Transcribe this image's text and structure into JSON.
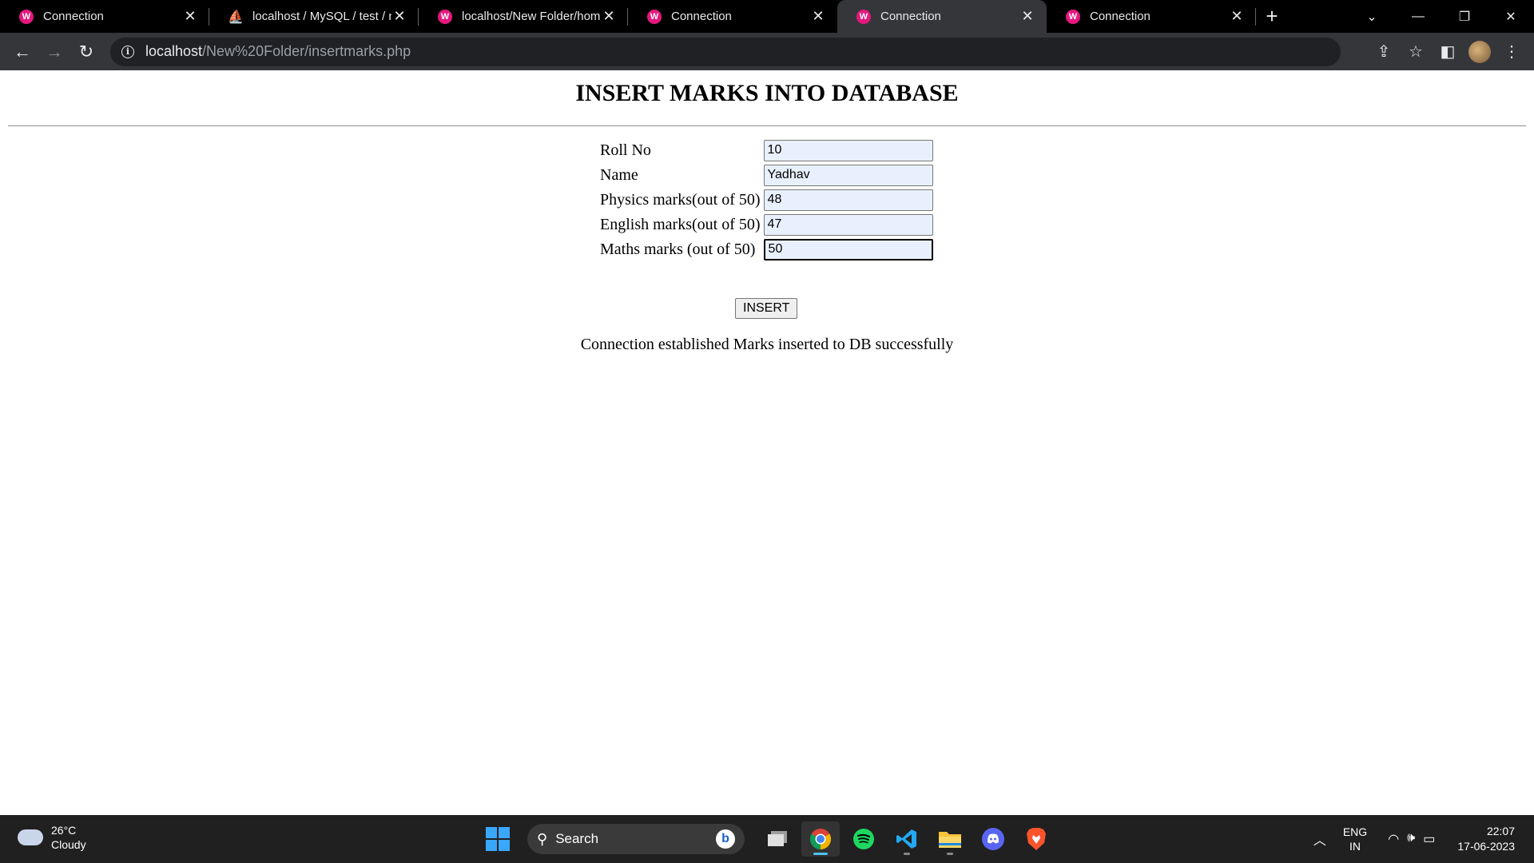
{
  "browser": {
    "tabs": [
      {
        "title": "Connection",
        "icon": "wamp-icon",
        "active": false
      },
      {
        "title": "localhost / MySQL / test / m",
        "icon": "phpmyadmin-icon",
        "active": false
      },
      {
        "title": "localhost/New Folder/home",
        "icon": "wamp-icon",
        "active": false
      },
      {
        "title": "Connection",
        "icon": "wamp-icon",
        "active": false
      },
      {
        "title": "Connection",
        "icon": "wamp-icon",
        "active": true
      },
      {
        "title": "Connection",
        "icon": "wamp-icon",
        "active": false
      }
    ],
    "url_host": "localhost",
    "url_path": "/New%20Folder/insertmarks.php"
  },
  "page": {
    "heading": "INSERT MARKS INTO DATABASE",
    "fields": [
      {
        "label": "Roll No",
        "value": "10"
      },
      {
        "label": "Name",
        "value": "Yadhav"
      },
      {
        "label": "Physics marks(out of 50)",
        "value": "48"
      },
      {
        "label": "English marks(out of 50)",
        "value": "47"
      },
      {
        "label": "Maths marks (out of 50)",
        "value": "50"
      }
    ],
    "submit_label": "INSERT",
    "status_message": "Connection established Marks inserted to DB successfully"
  },
  "taskbar": {
    "weather_temp": "26°C",
    "weather_desc": "Cloudy",
    "search_label": "Search",
    "lang_line1": "ENG",
    "lang_line2": "IN",
    "time": "22:07",
    "date": "17-06-2023",
    "accent_color": "#4cc2ff"
  }
}
